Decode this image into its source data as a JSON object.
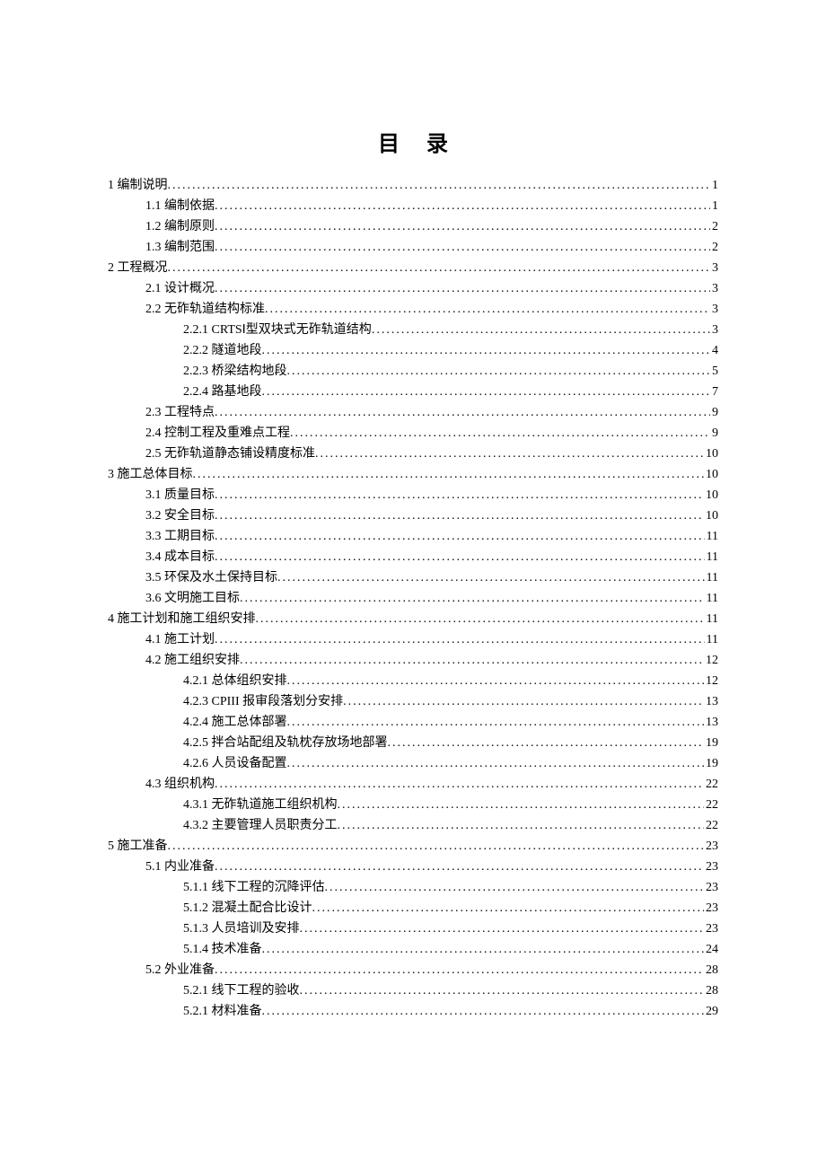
{
  "title": "目录",
  "entries": [
    {
      "level": 1,
      "label": "1 编制说明",
      "page": "1"
    },
    {
      "level": 2,
      "label": "1.1 编制依据",
      "page": "1"
    },
    {
      "level": 2,
      "label": "1.2 编制原则",
      "page": "2"
    },
    {
      "level": 2,
      "label": "1.3 编制范围",
      "page": "2"
    },
    {
      "level": 1,
      "label": "2 工程概况",
      "page": "3"
    },
    {
      "level": 2,
      "label": "2.1 设计概况",
      "page": "3"
    },
    {
      "level": 2,
      "label": "2.2 无砟轨道结构标准",
      "page": "3"
    },
    {
      "level": 3,
      "label": "2.2.1 CRTSⅠ型双块式无砟轨道结构",
      "page": "3"
    },
    {
      "level": 3,
      "label": "2.2.2 隧道地段",
      "page": "4"
    },
    {
      "level": 3,
      "label": "2.2.3 桥梁结构地段",
      "page": "5"
    },
    {
      "level": 3,
      "label": "2.2.4 路基地段",
      "page": "7"
    },
    {
      "level": 2,
      "label": "2.3 工程特点",
      "page": "9"
    },
    {
      "level": 2,
      "label": "2.4 控制工程及重难点工程",
      "page": "9"
    },
    {
      "level": 2,
      "label": "2.5 无砟轨道静态铺设精度标准",
      "page": "10"
    },
    {
      "level": 1,
      "label": "3 施工总体目标",
      "page": "10"
    },
    {
      "level": 2,
      "label": "3.1 质量目标",
      "page": "10"
    },
    {
      "level": 2,
      "label": "3.2 安全目标",
      "page": "10"
    },
    {
      "level": 2,
      "label": "3.3 工期目标",
      "page": "11"
    },
    {
      "level": 2,
      "label": "3.4 成本目标",
      "page": "11"
    },
    {
      "level": 2,
      "label": "3.5 环保及水土保持目标",
      "page": "11"
    },
    {
      "level": 2,
      "label": "3.6 文明施工目标",
      "page": "11"
    },
    {
      "level": 1,
      "label": "4 施工计划和施工组织安排",
      "page": "11"
    },
    {
      "level": 2,
      "label": "4.1 施工计划",
      "page": "11"
    },
    {
      "level": 2,
      "label": "4.2 施工组织安排",
      "page": "12"
    },
    {
      "level": 3,
      "label": "4.2.1 总体组织安排",
      "page": "12"
    },
    {
      "level": 3,
      "label": "4.2.3 CPIII 报审段落划分安排",
      "page": "13"
    },
    {
      "level": 3,
      "label": "4.2.4 施工总体部署",
      "page": "13"
    },
    {
      "level": 3,
      "label": "4.2.5 拌合站配组及轨枕存放场地部署",
      "page": "19"
    },
    {
      "level": 3,
      "label": "4.2.6 人员设备配置",
      "page": "19"
    },
    {
      "level": 2,
      "label": "4.3 组织机构",
      "page": "22"
    },
    {
      "level": 3,
      "label": "4.3.1 无砟轨道施工组织机构",
      "page": "22"
    },
    {
      "level": 3,
      "label": "4.3.2 主要管理人员职责分工",
      "page": "22"
    },
    {
      "level": 1,
      "label": "5 施工准备",
      "page": "23"
    },
    {
      "level": 2,
      "label": "5.1 内业准备",
      "page": "23"
    },
    {
      "level": 3,
      "label": "5.1.1 线下工程的沉降评估",
      "page": "23"
    },
    {
      "level": 3,
      "label": "5.1.2 混凝土配合比设计",
      "page": "23"
    },
    {
      "level": 3,
      "label": "5.1.3 人员培训及安排",
      "page": "23"
    },
    {
      "level": 3,
      "label": "5.1.4 技术准备",
      "page": "24"
    },
    {
      "level": 2,
      "label": "5.2 外业准备",
      "page": "28"
    },
    {
      "level": 3,
      "label": "5.2.1 线下工程的验收",
      "page": "28"
    },
    {
      "level": 3,
      "label": "5.2.1 材料准备",
      "page": "29"
    }
  ]
}
